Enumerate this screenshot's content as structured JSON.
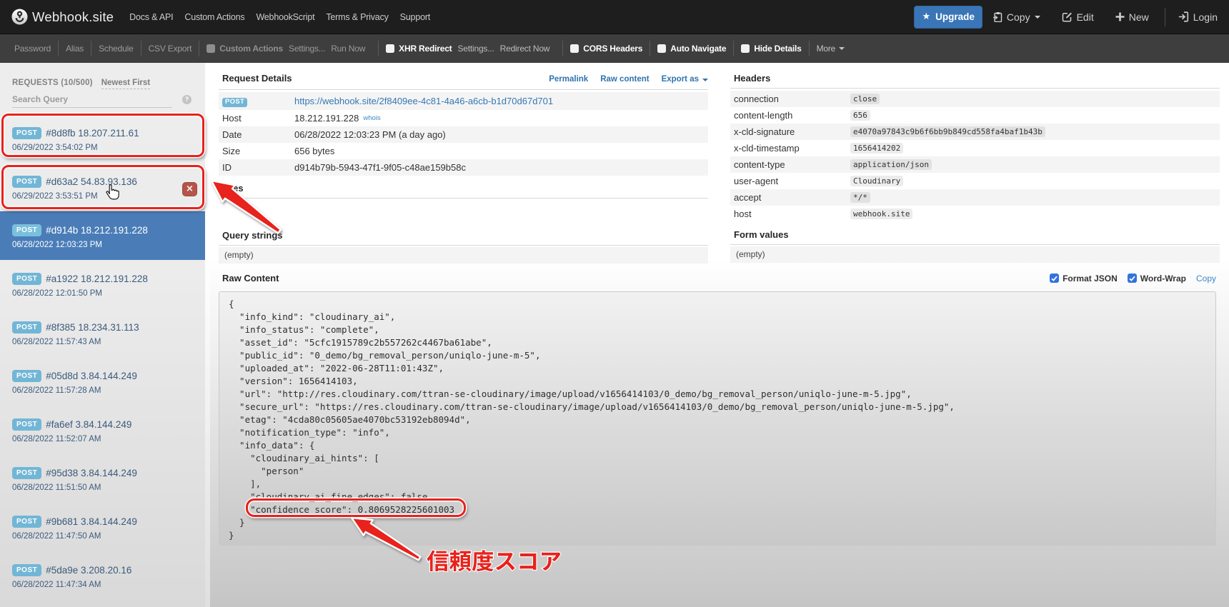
{
  "navbar": {
    "brand": "Webhook.site",
    "links": [
      {
        "label": "Docs & API"
      },
      {
        "label": "Custom Actions"
      },
      {
        "label": "WebhookScript"
      },
      {
        "label": "Terms & Privacy"
      },
      {
        "label": "Support"
      }
    ],
    "upgrade_label": "Upgrade",
    "copy_label": "Copy",
    "edit_label": "Edit",
    "new_label": "New",
    "login_label": "Login"
  },
  "toolbar": {
    "password": "Password",
    "alias": "Alias",
    "schedule": "Schedule",
    "csv_export": "CSV Export",
    "custom_actions": {
      "label": "Custom Actions",
      "settings": "Settings...",
      "run": "Run Now"
    },
    "xhr_redirect": {
      "label": "XHR Redirect",
      "settings": "Settings...",
      "redirect": "Redirect Now"
    },
    "cors_headers": "CORS Headers",
    "auto_navigate": "Auto Navigate",
    "hide_details": "Hide Details",
    "more": "More"
  },
  "sidebar": {
    "header": "REQUESTS (10/500)",
    "sort": "Newest First",
    "search_placeholder": "Search Query",
    "help_icon": "?",
    "delete_icon": "×",
    "requests": [
      {
        "method": "POST",
        "label": "#8d8fb 18.207.211.61",
        "time": "06/29/2022 3:54:02 PM"
      },
      {
        "method": "POST",
        "label": "#d63a2 54.83.93.136",
        "time": "06/29/2022 3:53:51 PM",
        "hovered": true
      },
      {
        "method": "POST",
        "label": "#d914b 18.212.191.228",
        "time": "06/28/2022 12:03:23 PM",
        "selected": true
      },
      {
        "method": "POST",
        "label": "#a1922 18.212.191.228",
        "time": "06/28/2022 12:01:50 PM"
      },
      {
        "method": "POST",
        "label": "#8f385 18.234.31.113",
        "time": "06/28/2022 11:57:43 AM"
      },
      {
        "method": "POST",
        "label": "#05d8d 3.84.144.249",
        "time": "06/28/2022 11:57:28 AM"
      },
      {
        "method": "POST",
        "label": "#fa6ef 3.84.144.249",
        "time": "06/28/2022 11:52:07 AM"
      },
      {
        "method": "POST",
        "label": "#95d38 3.84.144.249",
        "time": "06/28/2022 11:51:50 AM"
      },
      {
        "method": "POST",
        "label": "#9b681 3.84.144.249",
        "time": "06/28/2022 11:47:50 AM"
      },
      {
        "method": "POST",
        "label": "#5da9e 3.208.20.16",
        "time": "06/28/2022 11:47:34 AM"
      }
    ]
  },
  "request_details": {
    "title": "Request Details",
    "actions": {
      "permalink": "Permalink",
      "raw_content": "Raw content",
      "export_as": "Export as"
    },
    "method": "POST",
    "url": "https://webhook.site/2f8409ee-4c81-4a46-a6cb-b1d70d67d701",
    "labels": {
      "host": "Host",
      "date": "Date",
      "size": "Size",
      "id": "ID"
    },
    "host": "18.212.191.228",
    "whois": "whois",
    "date": "06/28/2022 12:03:23 PM (a day ago)",
    "size": "656 bytes",
    "id": "d914b79b-5943-47f1-9f05-c48ae159b58c"
  },
  "files": {
    "title": "Files"
  },
  "query_strings": {
    "title": "Query strings",
    "empty": "(empty)"
  },
  "headers": {
    "title": "Headers",
    "rows": [
      {
        "name": "connection",
        "value": "close"
      },
      {
        "name": "content-length",
        "value": "656"
      },
      {
        "name": "x-cld-signature",
        "value": "e4070a97843c9b6f6bb9b849cd558fa4baf1b43b"
      },
      {
        "name": "x-cld-timestamp",
        "value": "1656414202"
      },
      {
        "name": "content-type",
        "value": "application/json"
      },
      {
        "name": "user-agent",
        "value": "Cloudinary"
      },
      {
        "name": "accept",
        "value": "*/*"
      },
      {
        "name": "host",
        "value": "webhook.site"
      }
    ]
  },
  "form_values": {
    "title": "Form values",
    "empty": "(empty)"
  },
  "raw_content": {
    "title": "Raw Content",
    "format_json_label": "Format JSON",
    "word_wrap_label": "Word-Wrap",
    "copy_label": "Copy",
    "lines": [
      "{",
      "  \"info_kind\": \"cloudinary_ai\",",
      "  \"info_status\": \"complete\",",
      "  \"asset_id\": \"5cfc1915789c2b557262c4467ba61abe\",",
      "  \"public_id\": \"0_demo/bg_removal_person/uniqlo-june-m-5\",",
      "  \"uploaded_at\": \"2022-06-28T11:01:43Z\",",
      "  \"version\": 1656414103,",
      "  \"url\": \"http://res.cloudinary.com/ttran-se-cloudinary/image/upload/v1656414103/0_demo/bg_removal_person/uniqlo-june-m-5.jpg\",",
      "  \"secure_url\": \"https://res.cloudinary.com/ttran-se-cloudinary/image/upload/v1656414103/0_demo/bg_removal_person/uniqlo-june-m-5.jpg\",",
      "  \"etag\": \"4cda80c05605ae4070bc53192eb8094d\",",
      "  \"notification_type\": \"info\",",
      "  \"info_data\": {",
      "    \"cloudinary_ai_hints\": [",
      "      \"person\"",
      "    ],",
      "    \"cloudinary_ai_fine_edges\": false,",
      "    \"confidence_score\": 0.8069528225601003",
      "  }",
      "}"
    ]
  },
  "annotations": {
    "note_jp": "信頼度スコア",
    "red": "#e9201b"
  },
  "colors": {
    "accent_blue": "#337ab7",
    "selected_blue": "#4a7db8",
    "badge_blue": "#72b6d6",
    "link_blue": "#3577b4"
  }
}
